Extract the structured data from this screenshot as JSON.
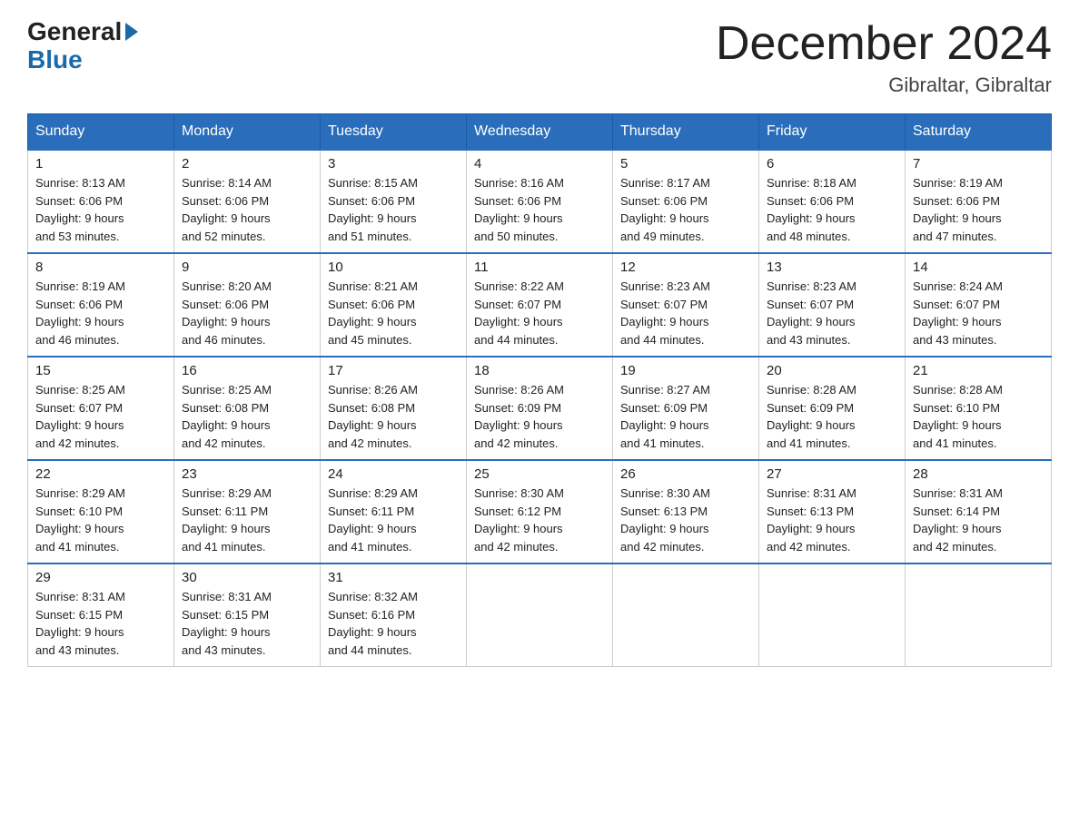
{
  "header": {
    "month_title": "December 2024",
    "location": "Gibraltar, Gibraltar",
    "logo_line1": "General",
    "logo_line2": "Blue"
  },
  "weekdays": [
    "Sunday",
    "Monday",
    "Tuesday",
    "Wednesday",
    "Thursday",
    "Friday",
    "Saturday"
  ],
  "weeks": [
    [
      {
        "day": "1",
        "sunrise": "8:13 AM",
        "sunset": "6:06 PM",
        "daylight": "9 hours and 53 minutes."
      },
      {
        "day": "2",
        "sunrise": "8:14 AM",
        "sunset": "6:06 PM",
        "daylight": "9 hours and 52 minutes."
      },
      {
        "day": "3",
        "sunrise": "8:15 AM",
        "sunset": "6:06 PM",
        "daylight": "9 hours and 51 minutes."
      },
      {
        "day": "4",
        "sunrise": "8:16 AM",
        "sunset": "6:06 PM",
        "daylight": "9 hours and 50 minutes."
      },
      {
        "day": "5",
        "sunrise": "8:17 AM",
        "sunset": "6:06 PM",
        "daylight": "9 hours and 49 minutes."
      },
      {
        "day": "6",
        "sunrise": "8:18 AM",
        "sunset": "6:06 PM",
        "daylight": "9 hours and 48 minutes."
      },
      {
        "day": "7",
        "sunrise": "8:19 AM",
        "sunset": "6:06 PM",
        "daylight": "9 hours and 47 minutes."
      }
    ],
    [
      {
        "day": "8",
        "sunrise": "8:19 AM",
        "sunset": "6:06 PM",
        "daylight": "9 hours and 46 minutes."
      },
      {
        "day": "9",
        "sunrise": "8:20 AM",
        "sunset": "6:06 PM",
        "daylight": "9 hours and 46 minutes."
      },
      {
        "day": "10",
        "sunrise": "8:21 AM",
        "sunset": "6:06 PM",
        "daylight": "9 hours and 45 minutes."
      },
      {
        "day": "11",
        "sunrise": "8:22 AM",
        "sunset": "6:07 PM",
        "daylight": "9 hours and 44 minutes."
      },
      {
        "day": "12",
        "sunrise": "8:23 AM",
        "sunset": "6:07 PM",
        "daylight": "9 hours and 44 minutes."
      },
      {
        "day": "13",
        "sunrise": "8:23 AM",
        "sunset": "6:07 PM",
        "daylight": "9 hours and 43 minutes."
      },
      {
        "day": "14",
        "sunrise": "8:24 AM",
        "sunset": "6:07 PM",
        "daylight": "9 hours and 43 minutes."
      }
    ],
    [
      {
        "day": "15",
        "sunrise": "8:25 AM",
        "sunset": "6:07 PM",
        "daylight": "9 hours and 42 minutes."
      },
      {
        "day": "16",
        "sunrise": "8:25 AM",
        "sunset": "6:08 PM",
        "daylight": "9 hours and 42 minutes."
      },
      {
        "day": "17",
        "sunrise": "8:26 AM",
        "sunset": "6:08 PM",
        "daylight": "9 hours and 42 minutes."
      },
      {
        "day": "18",
        "sunrise": "8:26 AM",
        "sunset": "6:09 PM",
        "daylight": "9 hours and 42 minutes."
      },
      {
        "day": "19",
        "sunrise": "8:27 AM",
        "sunset": "6:09 PM",
        "daylight": "9 hours and 41 minutes."
      },
      {
        "day": "20",
        "sunrise": "8:28 AM",
        "sunset": "6:09 PM",
        "daylight": "9 hours and 41 minutes."
      },
      {
        "day": "21",
        "sunrise": "8:28 AM",
        "sunset": "6:10 PM",
        "daylight": "9 hours and 41 minutes."
      }
    ],
    [
      {
        "day": "22",
        "sunrise": "8:29 AM",
        "sunset": "6:10 PM",
        "daylight": "9 hours and 41 minutes."
      },
      {
        "day": "23",
        "sunrise": "8:29 AM",
        "sunset": "6:11 PM",
        "daylight": "9 hours and 41 minutes."
      },
      {
        "day": "24",
        "sunrise": "8:29 AM",
        "sunset": "6:11 PM",
        "daylight": "9 hours and 41 minutes."
      },
      {
        "day": "25",
        "sunrise": "8:30 AM",
        "sunset": "6:12 PM",
        "daylight": "9 hours and 42 minutes."
      },
      {
        "day": "26",
        "sunrise": "8:30 AM",
        "sunset": "6:13 PM",
        "daylight": "9 hours and 42 minutes."
      },
      {
        "day": "27",
        "sunrise": "8:31 AM",
        "sunset": "6:13 PM",
        "daylight": "9 hours and 42 minutes."
      },
      {
        "day": "28",
        "sunrise": "8:31 AM",
        "sunset": "6:14 PM",
        "daylight": "9 hours and 42 minutes."
      }
    ],
    [
      {
        "day": "29",
        "sunrise": "8:31 AM",
        "sunset": "6:15 PM",
        "daylight": "9 hours and 43 minutes."
      },
      {
        "day": "30",
        "sunrise": "8:31 AM",
        "sunset": "6:15 PM",
        "daylight": "9 hours and 43 minutes."
      },
      {
        "day": "31",
        "sunrise": "8:32 AM",
        "sunset": "6:16 PM",
        "daylight": "9 hours and 44 minutes."
      },
      null,
      null,
      null,
      null
    ]
  ]
}
